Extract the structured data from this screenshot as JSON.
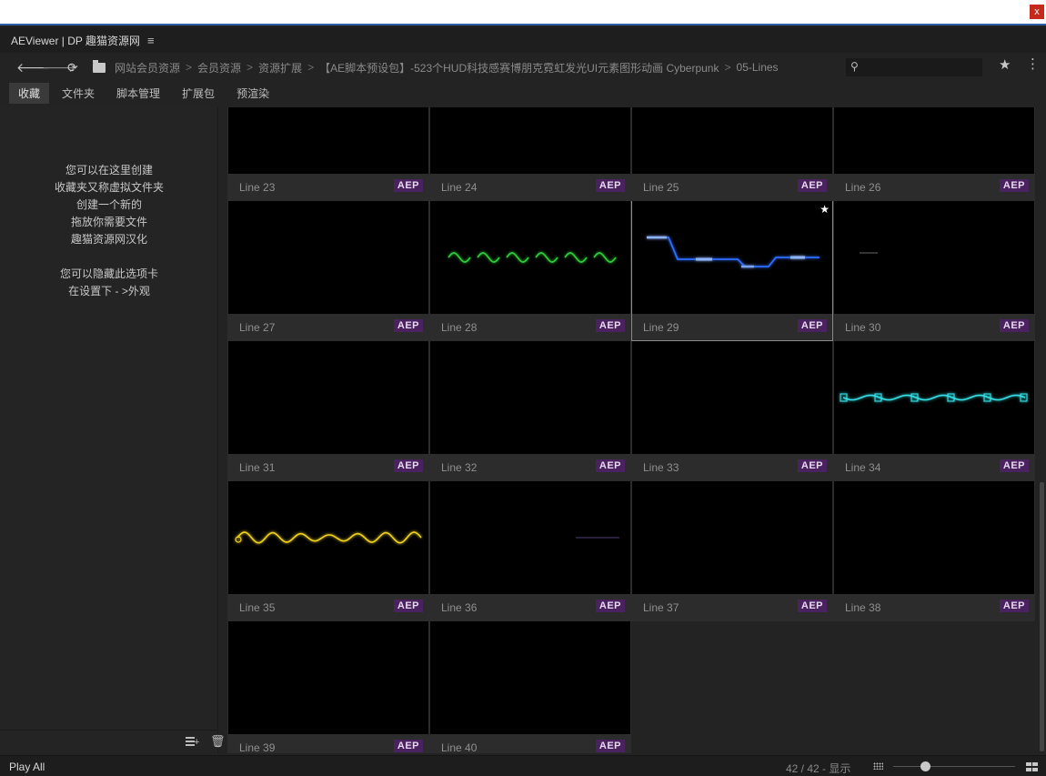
{
  "window": {
    "close_label": "x"
  },
  "title": {
    "app_name": "AEViewer | DP 趣猫资源网",
    "menu_icon": "≡"
  },
  "nav": {
    "breadcrumbs": [
      "网站会员资源",
      "会员资源",
      "资源扩展",
      "【AE脚本预设包】-523个HUD科技感赛博朋克霓虹发光UI元素图形动画 Cyberpunk",
      "05-Lines"
    ],
    "search": {
      "value": "",
      "placeholder": ""
    }
  },
  "tabs": [
    {
      "label": "收藏",
      "active": true
    },
    {
      "label": "文件夹"
    },
    {
      "label": "脚本管理"
    },
    {
      "label": "扩展包"
    },
    {
      "label": "预渲染"
    }
  ],
  "sidebar": {
    "message_lines": [
      "您可以在这里创建",
      "收藏夹又称虚拟文件夹",
      "创建一个新的",
      "拖放你需要文件",
      "趣猫资源网汉化",
      "",
      "您可以隐藏此选项卡",
      "在设置下 - >外观"
    ]
  },
  "items": [
    {
      "label": "Line 23",
      "badge": "AEP",
      "preview": "dots"
    },
    {
      "label": "Line 24",
      "badge": "AEP",
      "preview": "none"
    },
    {
      "label": "Line 25",
      "badge": "AEP",
      "preview": "none"
    },
    {
      "label": "Line 26",
      "badge": "AEP",
      "preview": "none"
    },
    {
      "label": "Line 27",
      "badge": "AEP",
      "preview": "none"
    },
    {
      "label": "Line 28",
      "badge": "AEP",
      "preview": "green-wave",
      "color": "#2fd03a"
    },
    {
      "label": "Line 29",
      "badge": "AEP",
      "preview": "blue-circuit",
      "color": "#2f6dff",
      "selected": true,
      "starred": true
    },
    {
      "label": "Line 30",
      "badge": "AEP",
      "preview": "spark"
    },
    {
      "label": "Line 31",
      "badge": "AEP",
      "preview": "none"
    },
    {
      "label": "Line 32",
      "badge": "AEP",
      "preview": "none"
    },
    {
      "label": "Line 33",
      "badge": "AEP",
      "preview": "none"
    },
    {
      "label": "Line 34",
      "badge": "AEP",
      "preview": "cyan-chain",
      "color": "#35e0e6"
    },
    {
      "label": "Line 35",
      "badge": "AEP",
      "preview": "yellow-wave",
      "color": "#f0d21c"
    },
    {
      "label": "Line 36",
      "badge": "AEP",
      "preview": "faint"
    },
    {
      "label": "Line 37",
      "badge": "AEP",
      "preview": "none"
    },
    {
      "label": "Line 38",
      "badge": "AEP",
      "preview": "none"
    },
    {
      "label": "Line 39",
      "badge": "AEP",
      "preview": "none"
    },
    {
      "label": "Line 40",
      "badge": "AEP",
      "preview": "none"
    }
  ],
  "status": {
    "play_all": "Play All",
    "count": "42 / 42 - 显示",
    "zoom": 0.26
  }
}
